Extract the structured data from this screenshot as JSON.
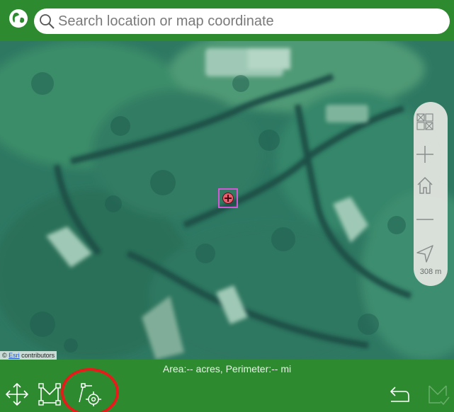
{
  "search": {
    "placeholder": "Search location or map coordinate",
    "value": ""
  },
  "map": {
    "scale_label": "308 m",
    "attribution_link": "Esri",
    "attribution_rest": " contributors"
  },
  "measure": {
    "summary": "Area:-- acres, Perimeter:-- mi"
  },
  "toolbar": {
    "tools": [
      "move-tool",
      "draw-polygon-tool",
      "add-point-tool",
      "undo-tool",
      "finish-tool"
    ]
  },
  "colors": {
    "bar": "#2d8a2f",
    "highlight": "#e81b1b",
    "target_border": "#d05ad6"
  }
}
